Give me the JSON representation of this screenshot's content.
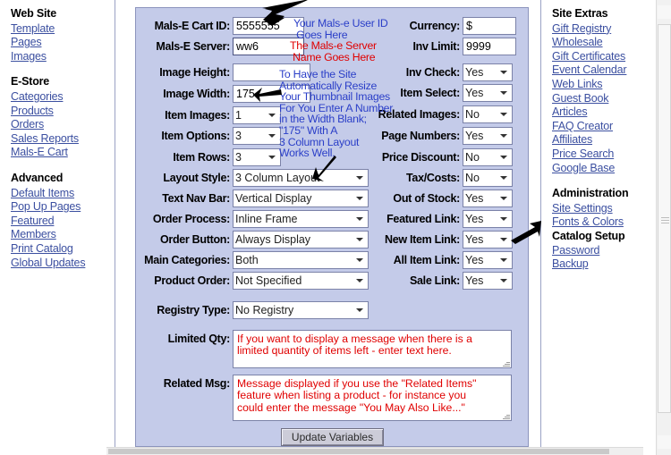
{
  "nav_left": {
    "groups": [
      {
        "title": "Web Site",
        "links": [
          "Template",
          "Pages",
          "Images"
        ]
      },
      {
        "title": "E-Store",
        "links": [
          "Categories",
          "Products",
          "Orders",
          "Sales Reports",
          "Mals-E Cart"
        ]
      },
      {
        "title": "Advanced",
        "links": [
          "Default Items",
          "Pop Up Pages",
          "Featured",
          "Members",
          "Print Catalog",
          "Global Updates"
        ]
      }
    ]
  },
  "nav_right": {
    "groups": [
      {
        "title": "Site Extras",
        "links": [
          "Gift Registry",
          "Wholesale",
          "Gift Certificates",
          "Event Calendar",
          "Web Links",
          "Guest Book",
          "Articles",
          "FAQ Creator",
          "Affiliates",
          "Price Search",
          "Google Base"
        ]
      },
      {
        "title": "Administration",
        "links": [
          "Site Settings",
          "Fonts & Colors",
          "Catalog Setup",
          "Password",
          "Backup"
        ],
        "current": "Catalog Setup"
      }
    ]
  },
  "form": {
    "left": {
      "cart_id": {
        "label": "Mals-E Cart ID:",
        "value": "5555555"
      },
      "server": {
        "label": "Mals-E Server:",
        "value": "ww6"
      },
      "image_height": {
        "label": "Image Height:",
        "value": ""
      },
      "image_width": {
        "label": "Image Width:",
        "value": "175"
      },
      "item_images": {
        "label": "Item Images:",
        "value": "1"
      },
      "item_options": {
        "label": "Item Options:",
        "value": "3"
      },
      "item_rows": {
        "label": "Item Rows:",
        "value": "3"
      },
      "layout_style": {
        "label": "Layout Style:",
        "value": "3 Column Layout"
      },
      "text_nav_bar": {
        "label": "Text Nav Bar:",
        "value": "Vertical Display"
      },
      "order_process": {
        "label": "Order Process:",
        "value": "Inline Frame"
      },
      "order_button": {
        "label": "Order Button:",
        "value": "Always Display"
      },
      "main_categories": {
        "label": "Main Categories:",
        "value": "Both"
      },
      "product_order": {
        "label": "Product Order:",
        "value": "Not Specified"
      },
      "registry_type": {
        "label": "Registry Type:",
        "value": "No Registry"
      }
    },
    "right": {
      "currency": {
        "label": "Currency:",
        "value": "$"
      },
      "inv_limit": {
        "label": "Inv Limit:",
        "value": "9999"
      },
      "inv_check": {
        "label": "Inv Check:",
        "value": "Yes"
      },
      "item_select": {
        "label": "Item Select:",
        "value": "Yes"
      },
      "related_images": {
        "label": "Related Images:",
        "value": "No"
      },
      "page_numbers": {
        "label": "Page Numbers:",
        "value": "Yes"
      },
      "price_discount": {
        "label": "Price Discount:",
        "value": "No"
      },
      "tax_costs": {
        "label": "Tax/Costs:",
        "value": "No"
      },
      "out_of_stock": {
        "label": "Out of Stock:",
        "value": "Yes"
      },
      "featured_link": {
        "label": "Featured Link:",
        "value": "Yes"
      },
      "new_item_link": {
        "label": "New Item Link:",
        "value": "Yes"
      },
      "all_item_link": {
        "label": "All Item Link:",
        "value": "Yes"
      },
      "sale_link": {
        "label": "Sale Link:",
        "value": "Yes"
      }
    },
    "textareas": {
      "limited_qty": {
        "label": "Limited Qty:",
        "value": "If you want to display a message when there is a\nlimited quantity of items left - enter text here."
      },
      "related_msg": {
        "label": "Related Msg:",
        "value": "Message displayed if you use the \"Related Items\"\nfeature when listing a product - for instance you\ncould enter the message \"You May Also Like...\""
      }
    },
    "submit_label": "Update Variables",
    "yesno_options": [
      "Yes",
      "No"
    ]
  },
  "annotations": {
    "cart_id_note": "Your Mals-e User ID\n Goes Here",
    "server_note": "The Mals-e Server\n Name Goes Here",
    "width_note": "To Have the Site\nAutomatically Resize\nYour Thumbnail Images\nFor You Enter A Number\nin the Width Blank;\n\"175\" With A\n3 Column Layout\nWorks Well."
  },
  "colors": {
    "panel_bg": "#c4cbe9",
    "link": "#3b4fa0",
    "anno_blue": "#2b3fc8",
    "anno_red": "#e00000"
  }
}
